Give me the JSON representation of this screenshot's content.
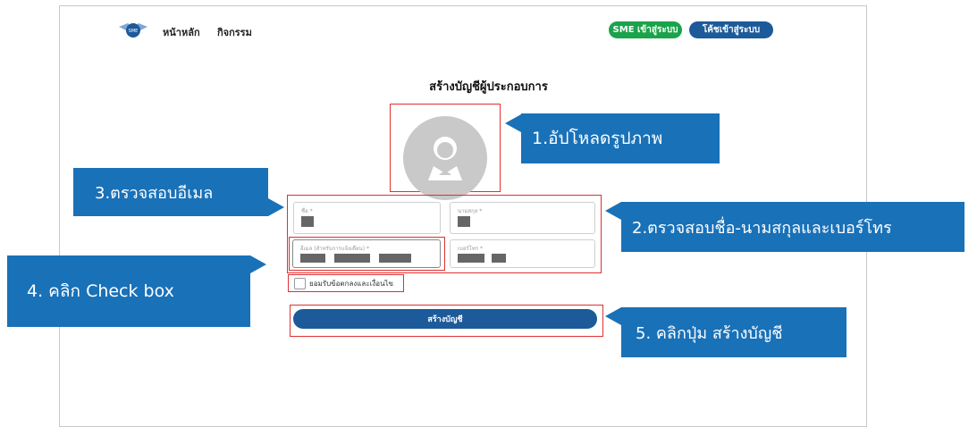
{
  "header": {
    "nav": [
      "หน้าหลัก",
      "กิจกรรม"
    ],
    "sme_login": "SME เข้าสู่ระบบ",
    "coach_login": "โค้ชเข้าสู่ระบบ",
    "logo_text": "SME"
  },
  "form": {
    "title": "สร้างบัญชีผู้ประกอบการ",
    "first_name_label": "ชื่อ *",
    "last_name_label": "นามสกุล *",
    "email_label": "อีเมล (สำหรับการแจ้งเตือน) *",
    "phone_label": "เบอร์โทร *",
    "accept_terms": "ยอมรับข้อตกลงและเงื่อนไข",
    "submit": "สร้างบัญชี"
  },
  "callouts": {
    "upload": "1.อัปโหลดรูปภาพ",
    "name_phone": "2.ตรวจสอบชื่อ-นามสกุลและเบอร์โทร",
    "email": "3.ตรวจสอบอีเมล",
    "checkbox": "4. คลิก Check box",
    "button": "5. คลิกปุ่ม สร้างบัญชี"
  },
  "colors": {
    "callout_bg": "#1971b8",
    "sme_pill": "#1aa34a",
    "coach_pill": "#1c5a9a",
    "highlight_border": "#e03030"
  }
}
